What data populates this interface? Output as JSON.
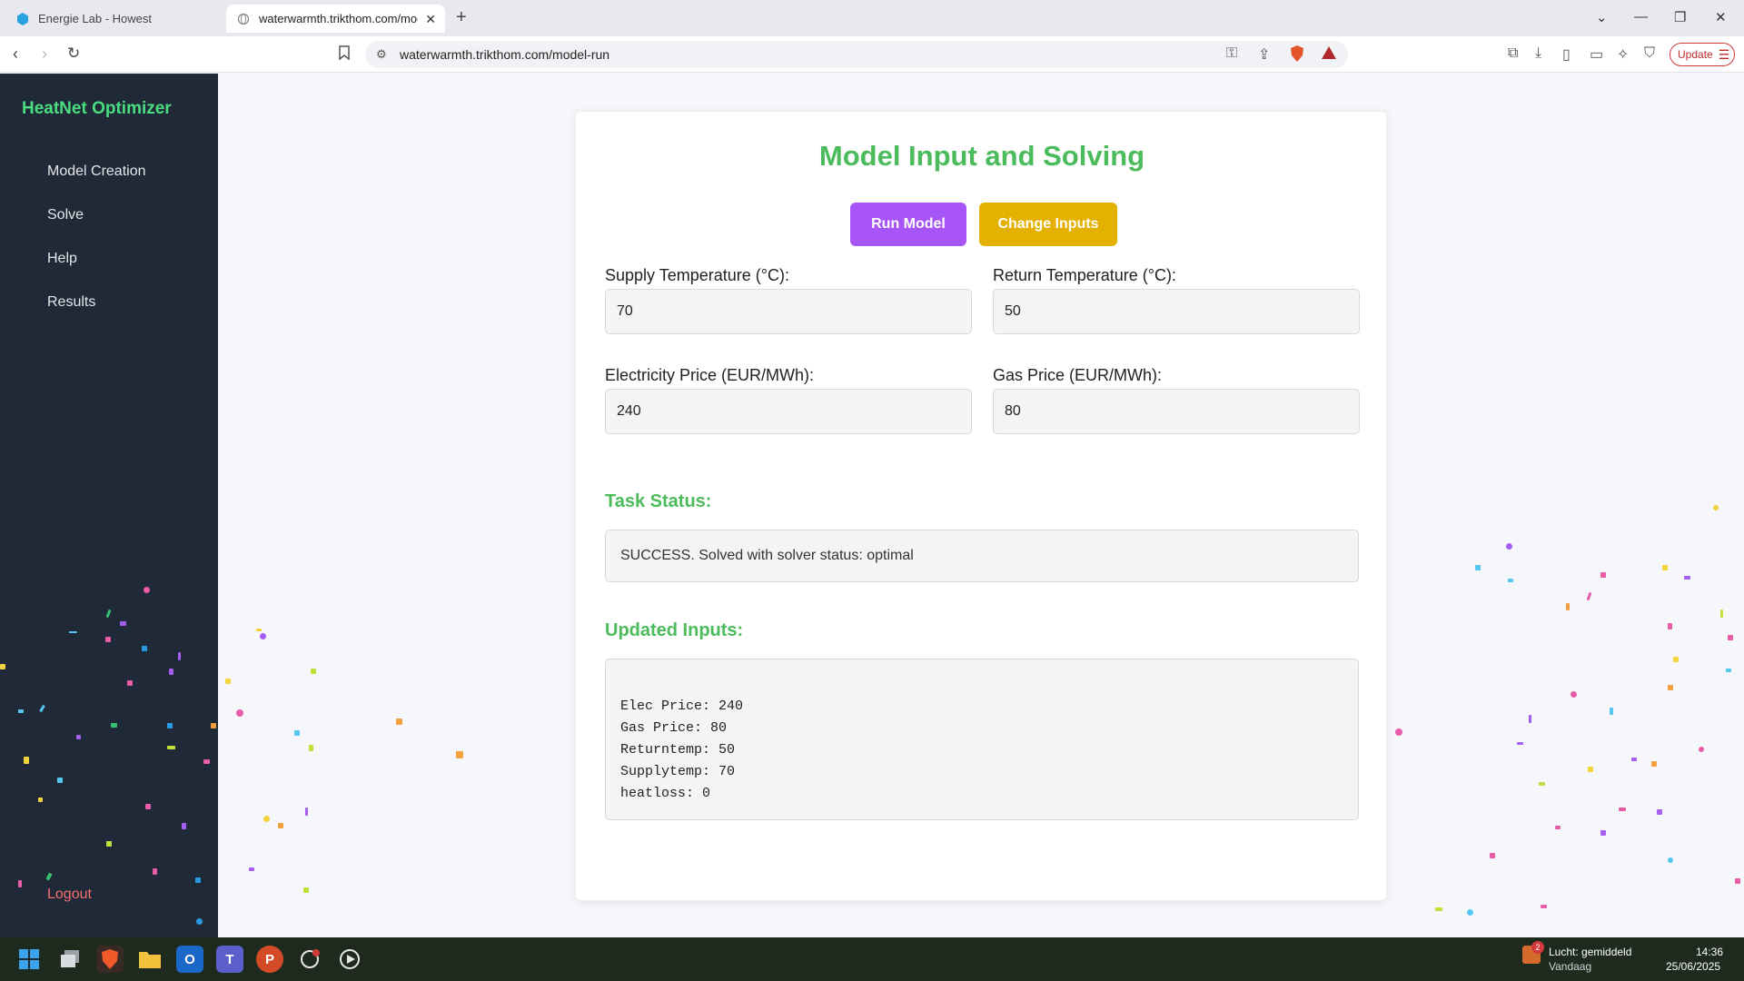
{
  "browser": {
    "tabs": [
      {
        "title": "Energie Lab - Howest",
        "active": false
      },
      {
        "title": "waterwarmth.trikthom.com/mod",
        "active": true
      }
    ],
    "url": "waterwarmth.trikthom.com/model-run",
    "update_label": "Update"
  },
  "sidebar": {
    "brand": "HeatNet Optimizer",
    "items": [
      {
        "label": "Model Creation"
      },
      {
        "label": "Solve"
      },
      {
        "label": "Help"
      },
      {
        "label": "Results"
      }
    ],
    "logout": "Logout"
  },
  "main": {
    "title": "Model Input and Solving",
    "run_button": "Run Model",
    "change_button": "Change Inputs",
    "fields": {
      "supply": {
        "label": "Supply Temperature (°C):",
        "value": "70"
      },
      "return": {
        "label": "Return Temperature (°C):",
        "value": "50"
      },
      "electricity": {
        "label": "Electricity Price (EUR/MWh):",
        "value": "240"
      },
      "gas": {
        "label": "Gas Price (EUR/MWh):",
        "value": "80"
      }
    },
    "task_status": {
      "heading": "Task Status:",
      "message": "SUCCESS. Solved with solver status: optimal"
    },
    "updated_inputs": {
      "heading": "Updated Inputs:",
      "lines": [
        "Elec Price: 240",
        "Gas Price: 80",
        "Returntemp: 50",
        "Supplytemp: 70",
        "heatloss: 0"
      ]
    }
  },
  "colors": {
    "accent_green": "#4cbb5b",
    "run_button": "#a855f7",
    "change_button": "#e4b100",
    "sidebar_bg": "#1f2937",
    "logout": "#f87171"
  },
  "taskbar": {
    "weather": "Lucht: gemiddeld",
    "weather_sub": "Vandaag",
    "weather_badge": "2",
    "time": "14:36",
    "date": "25/06/2025"
  }
}
